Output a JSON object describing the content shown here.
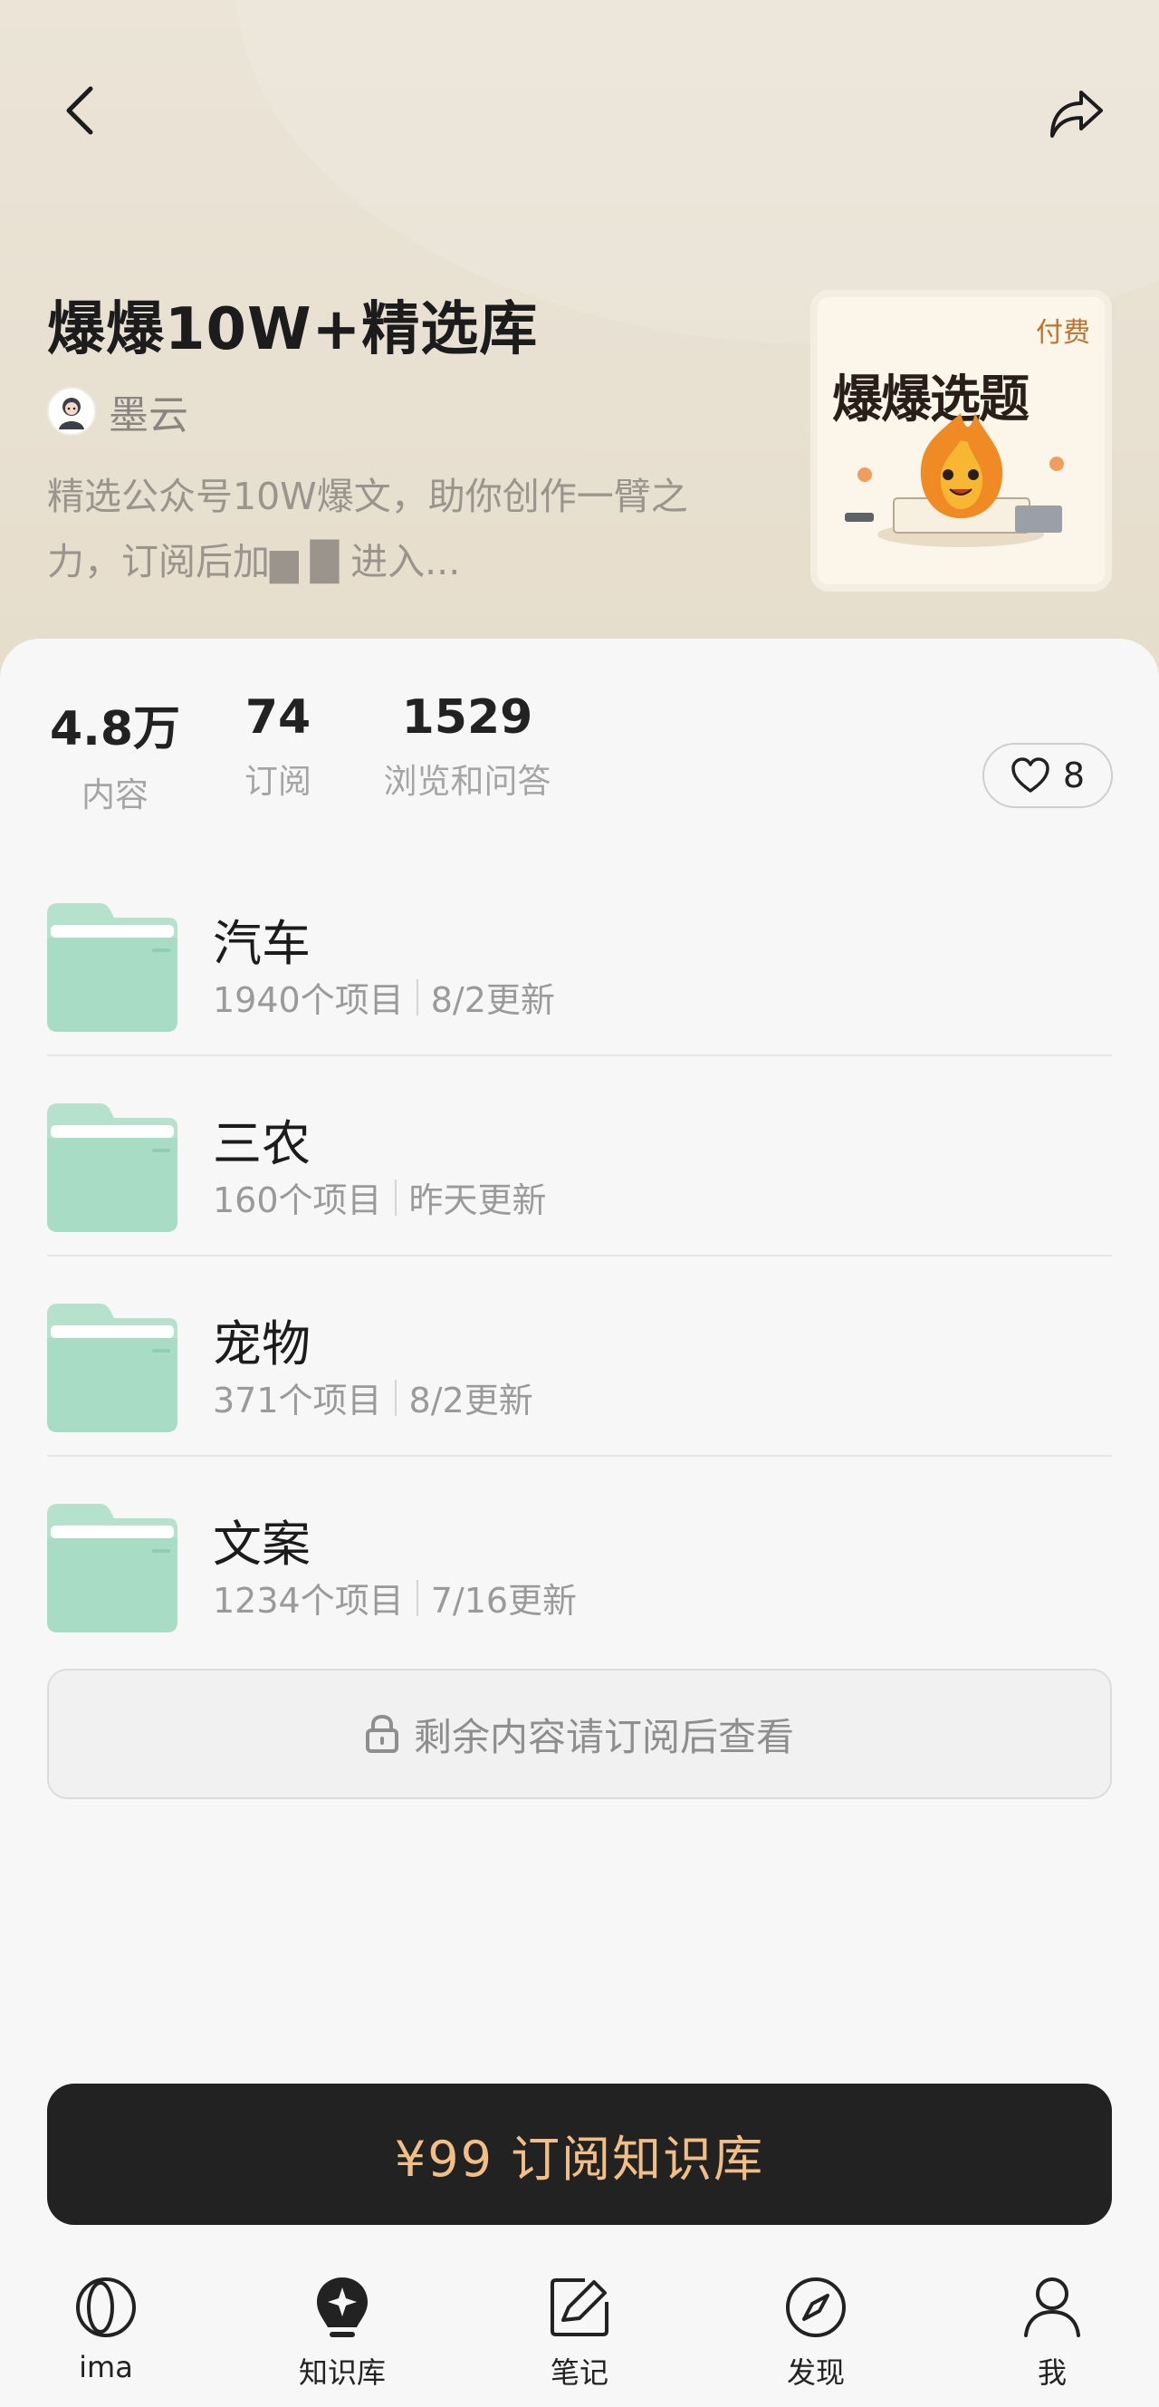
{
  "header": {
    "back_icon": "chevron-left-icon",
    "share_icon": "share-icon"
  },
  "knowledge_base": {
    "title": "爆爆10W+精选库",
    "author": "墨云",
    "description": "精选公众号10W爆文，助你创作一臂之力，订阅后加▆ █ 进入...",
    "cover": {
      "badge": "付费",
      "title": "爆爆选题"
    }
  },
  "stats": [
    {
      "value": "4.8万",
      "label": "内容"
    },
    {
      "value": "74",
      "label": "订阅"
    },
    {
      "value": "1529",
      "label": "浏览和问答"
    }
  ],
  "likes": "8",
  "folders": [
    {
      "name": "汽车",
      "count": "1940个项目",
      "updated": "8/2更新"
    },
    {
      "name": "三农",
      "count": "160个项目",
      "updated": "昨天更新"
    },
    {
      "name": "宠物",
      "count": "371个项目",
      "updated": "8/2更新"
    },
    {
      "name": "文案",
      "count": "1234个项目",
      "updated": "7/16更新"
    }
  ],
  "locked_notice": "剩余内容请订阅后查看",
  "subscribe_button": "¥99 订阅知识库",
  "tabs": [
    {
      "label": "ima",
      "icon": "ima-logo-icon"
    },
    {
      "label": "知识库",
      "icon": "knowledge-base-icon",
      "active": true
    },
    {
      "label": "笔记",
      "icon": "note-icon"
    },
    {
      "label": "发现",
      "icon": "compass-icon"
    },
    {
      "label": "我",
      "icon": "person-icon"
    }
  ],
  "colors": {
    "hero_bg": "#e8e0d1",
    "folder": "#a9dcc4",
    "subscribe_bg": "#222222",
    "subscribe_text": "#f0be86",
    "badge": "#c2712a"
  }
}
